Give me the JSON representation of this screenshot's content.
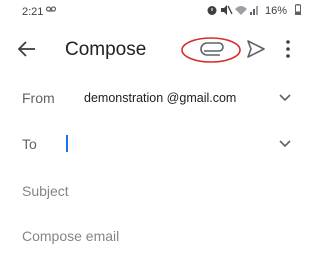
{
  "status_bar": {
    "time": "2:21",
    "battery": "16%"
  },
  "toolbar": {
    "title": "Compose",
    "attach_highlight_color": "#d32f2f"
  },
  "form": {
    "from_label": "From",
    "from_value": "demonstration @gmail.com",
    "to_label": "To",
    "to_value": "",
    "subject_placeholder": "Subject",
    "body_placeholder": "Compose email"
  },
  "icons": [
    "voicemail-icon",
    "alarm-icon",
    "mute-icon",
    "wifi-icon",
    "signal-icon",
    "battery-icon",
    "back-arrow-icon",
    "paperclip-icon",
    "send-icon",
    "more-vert-icon",
    "chevron-down-icon"
  ],
  "colors": {
    "accent": "#1a73e8",
    "highlight": "#d32f2f"
  }
}
